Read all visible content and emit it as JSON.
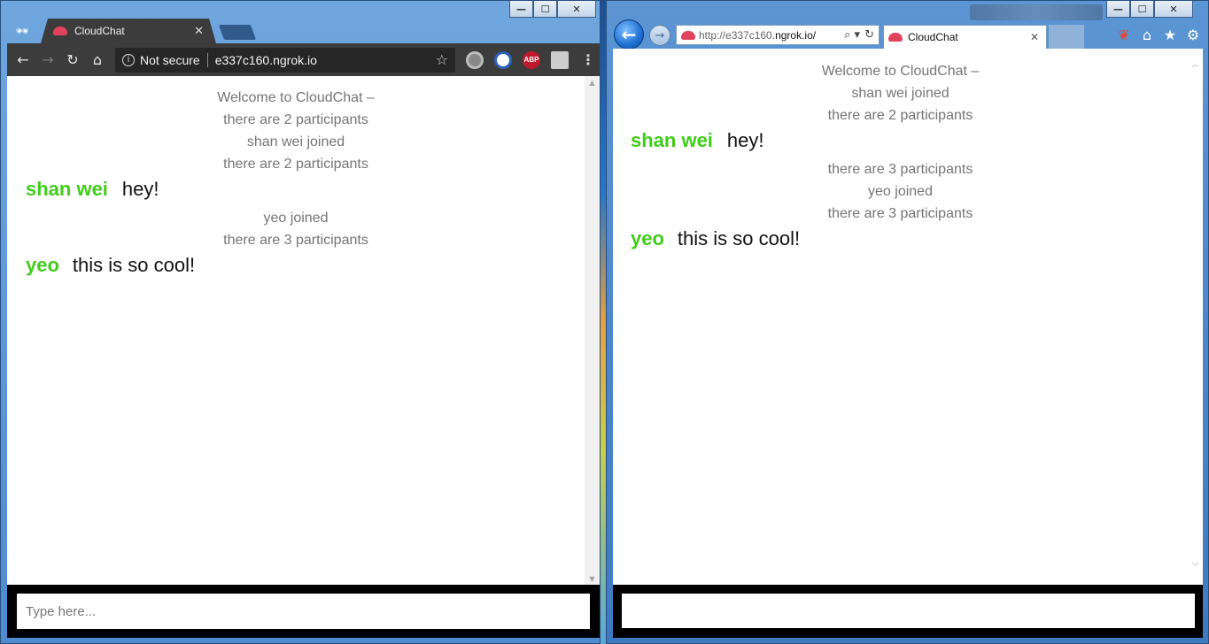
{
  "left_browser": {
    "tab": {
      "title": "CloudChat",
      "close": "✕"
    },
    "incognito_icon": "🕶",
    "toolbar": {
      "back": "←",
      "forward": "→",
      "reload": "↻",
      "home": "⌂",
      "security_label": "Not secure",
      "info_glyph": "i",
      "url": "e337c160.ngrok.io",
      "star": "☆",
      "abp_label": "ABP",
      "menu": "⋮"
    },
    "chat": {
      "messages": [
        {
          "type": "system",
          "lines": [
            "Welcome to CloudChat –",
            "there are 2 participants"
          ]
        },
        {
          "type": "system",
          "lines": [
            "shan wei joined",
            "there are 2 participants"
          ]
        },
        {
          "type": "chat",
          "user": "shan wei",
          "text": "hey!"
        },
        {
          "type": "system",
          "lines": [
            "yeo joined",
            "there are 3 participants"
          ]
        },
        {
          "type": "chat",
          "user": "yeo",
          "text": "this is so cool!"
        }
      ]
    },
    "input": {
      "placeholder": "Type here..."
    }
  },
  "right_browser": {
    "address": {
      "url_prefix": "http://e337c160.",
      "url_domain": "ngrok.io/",
      "search_glyph": "⌕ ▾",
      "refresh_glyph": "↻"
    },
    "tab": {
      "title": "CloudChat",
      "close": "✕"
    },
    "nav": {
      "back": "←",
      "forward": "→"
    },
    "icons": {
      "home": "⌂",
      "favorites": "★",
      "tools": "⚙"
    },
    "chat": {
      "messages": [
        {
          "type": "system",
          "lines": [
            "Welcome to CloudChat –",
            "shan wei joined",
            "there are 2 participants"
          ]
        },
        {
          "type": "chat",
          "user": "shan wei",
          "text": "hey!"
        },
        {
          "type": "system",
          "lines": [
            "there are 3 participants",
            "yeo joined",
            "there are 3 participants"
          ]
        },
        {
          "type": "chat",
          "user": "yeo",
          "text": "this is so cool!"
        }
      ]
    },
    "input": {
      "placeholder": ""
    }
  },
  "window_controls": {
    "minimize": "—",
    "maximize": "☐",
    "close": "✕"
  },
  "colors": {
    "username": "#41cc1b",
    "system_text": "#757575",
    "input_bar": "#000000"
  }
}
